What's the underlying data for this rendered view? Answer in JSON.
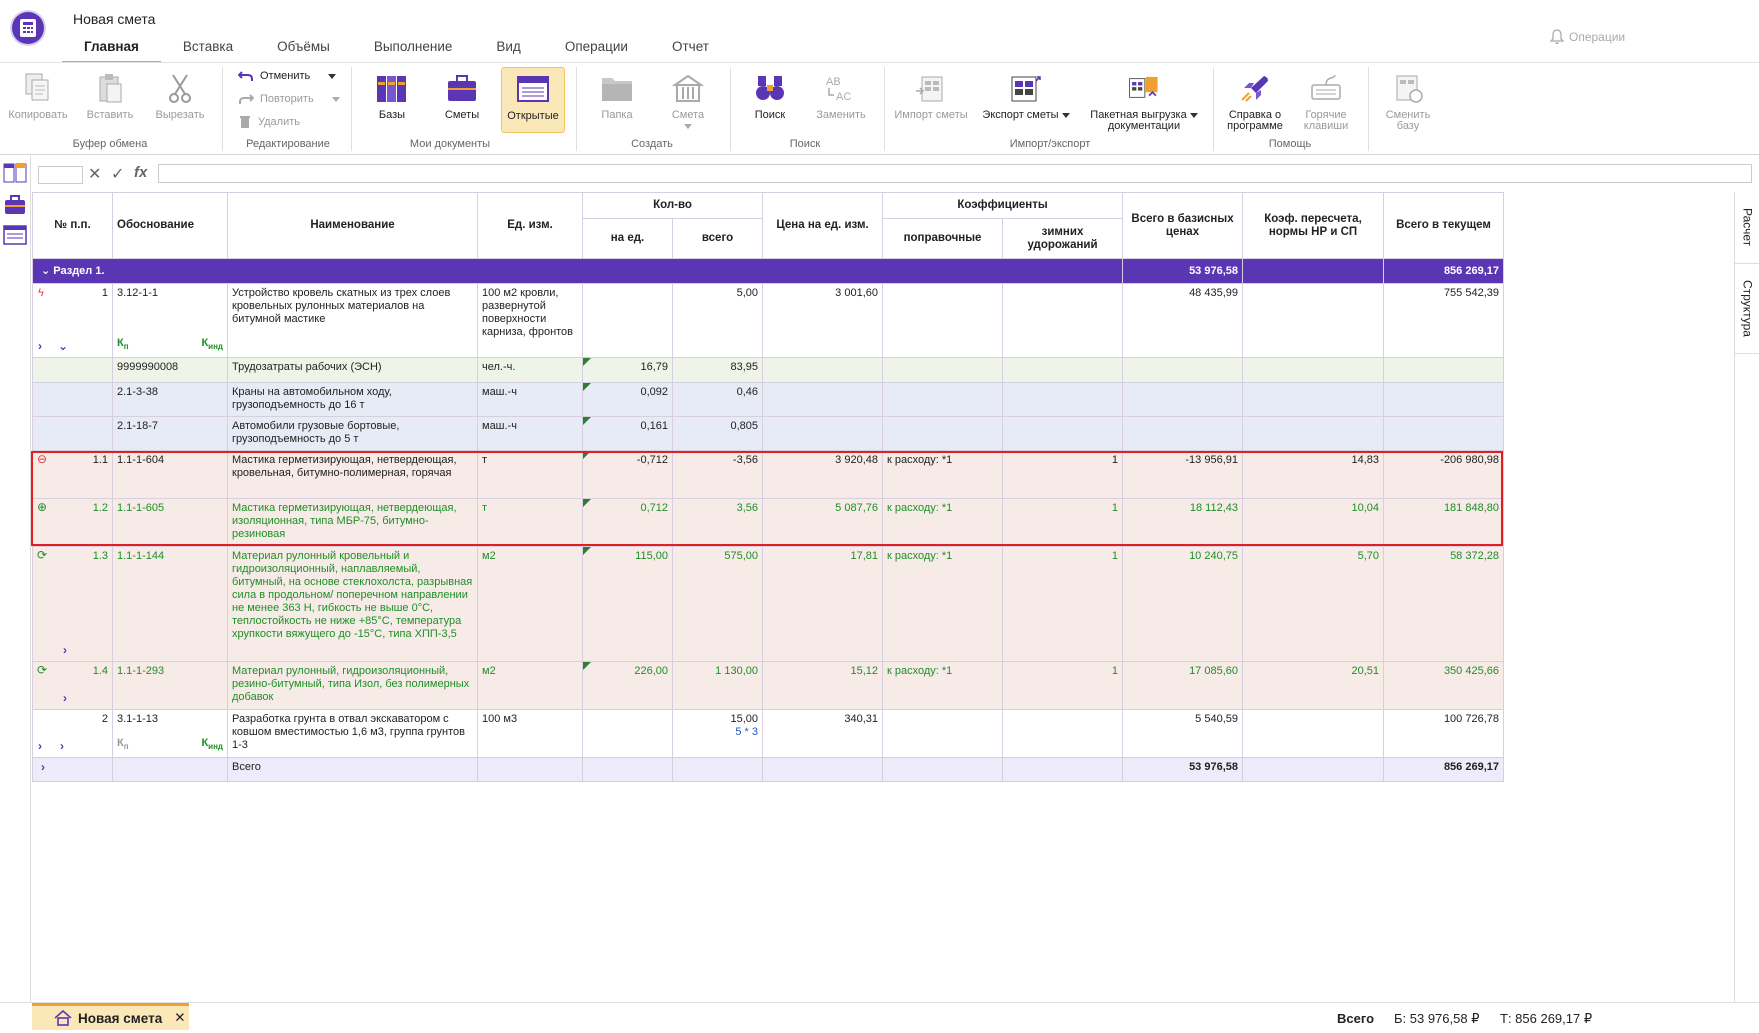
{
  "app": {
    "title": "Новая смета",
    "tabs": [
      "Главная",
      "Вставка",
      "Объёмы",
      "Выполнение",
      "Вид",
      "Операции",
      "Отчет"
    ],
    "ops_label": "Операции"
  },
  "ribbon": {
    "clipboard": {
      "copy": "Копировать",
      "paste": "Вставить",
      "cut": "Вырезать",
      "label": "Буфер обмена"
    },
    "edit": {
      "undo": "Отменить",
      "redo": "Повторить",
      "delete": "Удалить",
      "label": "Редактирование"
    },
    "docs": {
      "bases": "Базы",
      "estimates": "Сметы",
      "open": "Открытые",
      "label": "Мои документы"
    },
    "create": {
      "folder": "Папка",
      "estimate": "Смета",
      "label": "Создать"
    },
    "search": {
      "search": "Поиск",
      "replace": "Заменить",
      "label": "Поиск"
    },
    "io": {
      "import": "Импорт сметы",
      "export": "Экспорт сметы",
      "batch1": "Пакетная выгрузка",
      "batch2": "документации",
      "label": "Импорт/экспорт"
    },
    "help": {
      "about1": "Справка о",
      "about2": "программе",
      "hot1": "Горячие",
      "hot2": "клавиши",
      "switch1": "Сменить",
      "switch2": "базу",
      "label": "Помощь"
    }
  },
  "grid": {
    "headers": {
      "num": "№ п.п.",
      "basis": "Обоснование",
      "name": "Наименование",
      "unit": "Ед. изм.",
      "qty": "Кол-во",
      "qty_per": "на ед.",
      "qty_total": "всего",
      "price": "Цена на ед. изм.",
      "coef": "Коэффициенты",
      "coef_corr": "поправочные",
      "coef_winter": "зимних удорожаний",
      "base_total": "Всего в базисных ценах",
      "recalc": "Коэф. пересчета, нормы НР и СП",
      "cur_total": "Всего в текущем"
    },
    "section": {
      "label": "Раздел 1.",
      "base_total": "53 976,58",
      "cur_total": "856 269,17"
    },
    "kp": "К",
    "kp_sub": "п",
    "kind_sub": "инд",
    "rows": [
      {
        "num": "1",
        "basis": "3.12-1-1",
        "name": "Устройство кровель скатных из трех слоев кровельных рулонных материалов на битумной мастике",
        "unit": "100 м2 кровли, развернутой поверхности карниза, фронтов",
        "qty_per": "",
        "qty_total": "5,00",
        "price": "3 001,60",
        "coef_corr": "",
        "coef_winter": "",
        "base_total": "48 435,99",
        "recalc": "",
        "cur_total": "755 542,39"
      },
      {
        "num": "",
        "basis": "9999990008",
        "name": "Трудозатраты рабочих (ЭСН)",
        "unit": "чел.-ч.",
        "qty_per": "16,79",
        "qty_total": "83,95",
        "price": "",
        "coef_corr": "",
        "coef_winter": "",
        "base_total": "",
        "recalc": "",
        "cur_total": ""
      },
      {
        "num": "",
        "basis": "2.1-3-38",
        "name": "Краны на автомобильном ходу, грузоподъемность до 16 т",
        "unit": "маш.-ч",
        "qty_per": "0,092",
        "qty_total": "0,46",
        "price": "",
        "coef_corr": "",
        "coef_winter": "",
        "base_total": "",
        "recalc": "",
        "cur_total": ""
      },
      {
        "num": "",
        "basis": "2.1-18-7",
        "name": "Автомобили грузовые бортовые, грузоподъемность до 5 т",
        "unit": "маш.-ч",
        "qty_per": "0,161",
        "qty_total": "0,805",
        "price": "",
        "coef_corr": "",
        "coef_winter": "",
        "base_total": "",
        "recalc": "",
        "cur_total": ""
      },
      {
        "num": "1.1",
        "basis": "1.1-1-604",
        "name": "Мастика герметизирующая, нетвердеющая, кровельная, битумно-полимерная, горячая",
        "unit": "т",
        "qty_per": "-0,712",
        "qty_total": "-3,56",
        "price": "3 920,48",
        "coef_corr": "к расходу: *1",
        "coef_winter": "1",
        "base_total": "-13 956,91",
        "recalc": "14,83",
        "cur_total": "-206 980,98"
      },
      {
        "num": "1.2",
        "basis": "1.1-1-605",
        "name": "Мастика герметизирующая, нетвердеющая, изоляционная, типа МБР-75, битумно-резиновая",
        "unit": "т",
        "qty_per": "0,712",
        "qty_total": "3,56",
        "price": "5 087,76",
        "coef_corr": "к расходу: *1",
        "coef_winter": "1",
        "base_total": "18 112,43",
        "recalc": "10,04",
        "cur_total": "181 848,80"
      },
      {
        "num": "1.3",
        "basis": "1.1-1-144",
        "name": "Материал рулонный кровельный и гидроизоляционный, наплавляемый, битумный, на основе стеклохолста, разрывная сила в продольном/ поперечном направлении не менее 363 Н, гибкость не выше 0°С, теплостойкость не ниже +85°С, температура хрупкости вяжущего до -15°С, типа ХПП-3,5",
        "unit": "м2",
        "qty_per": "115,00",
        "qty_total": "575,00",
        "price": "17,81",
        "coef_corr": "к расходу: *1",
        "coef_winter": "1",
        "base_total": "10 240,75",
        "recalc": "5,70",
        "cur_total": "58 372,28"
      },
      {
        "num": "1.4",
        "basis": "1.1-1-293",
        "name": "Материал рулонный, гидроизоляционный, резино-битумный, типа Изол, без полимерных добавок",
        "unit": "м2",
        "qty_per": "226,00",
        "qty_total": "1 130,00",
        "price": "15,12",
        "coef_corr": "к расходу: *1",
        "coef_winter": "1",
        "base_total": "17 085,60",
        "recalc": "20,51",
        "cur_total": "350 425,66"
      },
      {
        "num": "2",
        "basis": "3.1-1-13",
        "name": "Разработка грунта в отвал экскаватором с ковшом вместимостью 1,6 м3, группа грунтов 1-3",
        "unit": "100 м3",
        "qty_per": "",
        "qty_total": "15,00",
        "qty_note": "5 * 3",
        "price": "340,31",
        "coef_corr": "",
        "coef_winter": "",
        "base_total": "5 540,59",
        "recalc": "",
        "cur_total": "100 726,78"
      }
    ],
    "total": {
      "label": "Всего",
      "base_total": "53 976,58",
      "cur_total": "856 269,17"
    }
  },
  "side_tabs": [
    "Расчет",
    "Структура"
  ],
  "bottom": {
    "doc_tab": "Новая смета",
    "total_label": "Всего",
    "base": "Б: 53 976,58 ₽",
    "cur": "Т: 856 269,17 ₽"
  },
  "colors": {
    "accent": "#5b36b4",
    "tab_underline": "#f0a030",
    "green_text": "#1e8f26",
    "highlight_box": "#e02020"
  }
}
